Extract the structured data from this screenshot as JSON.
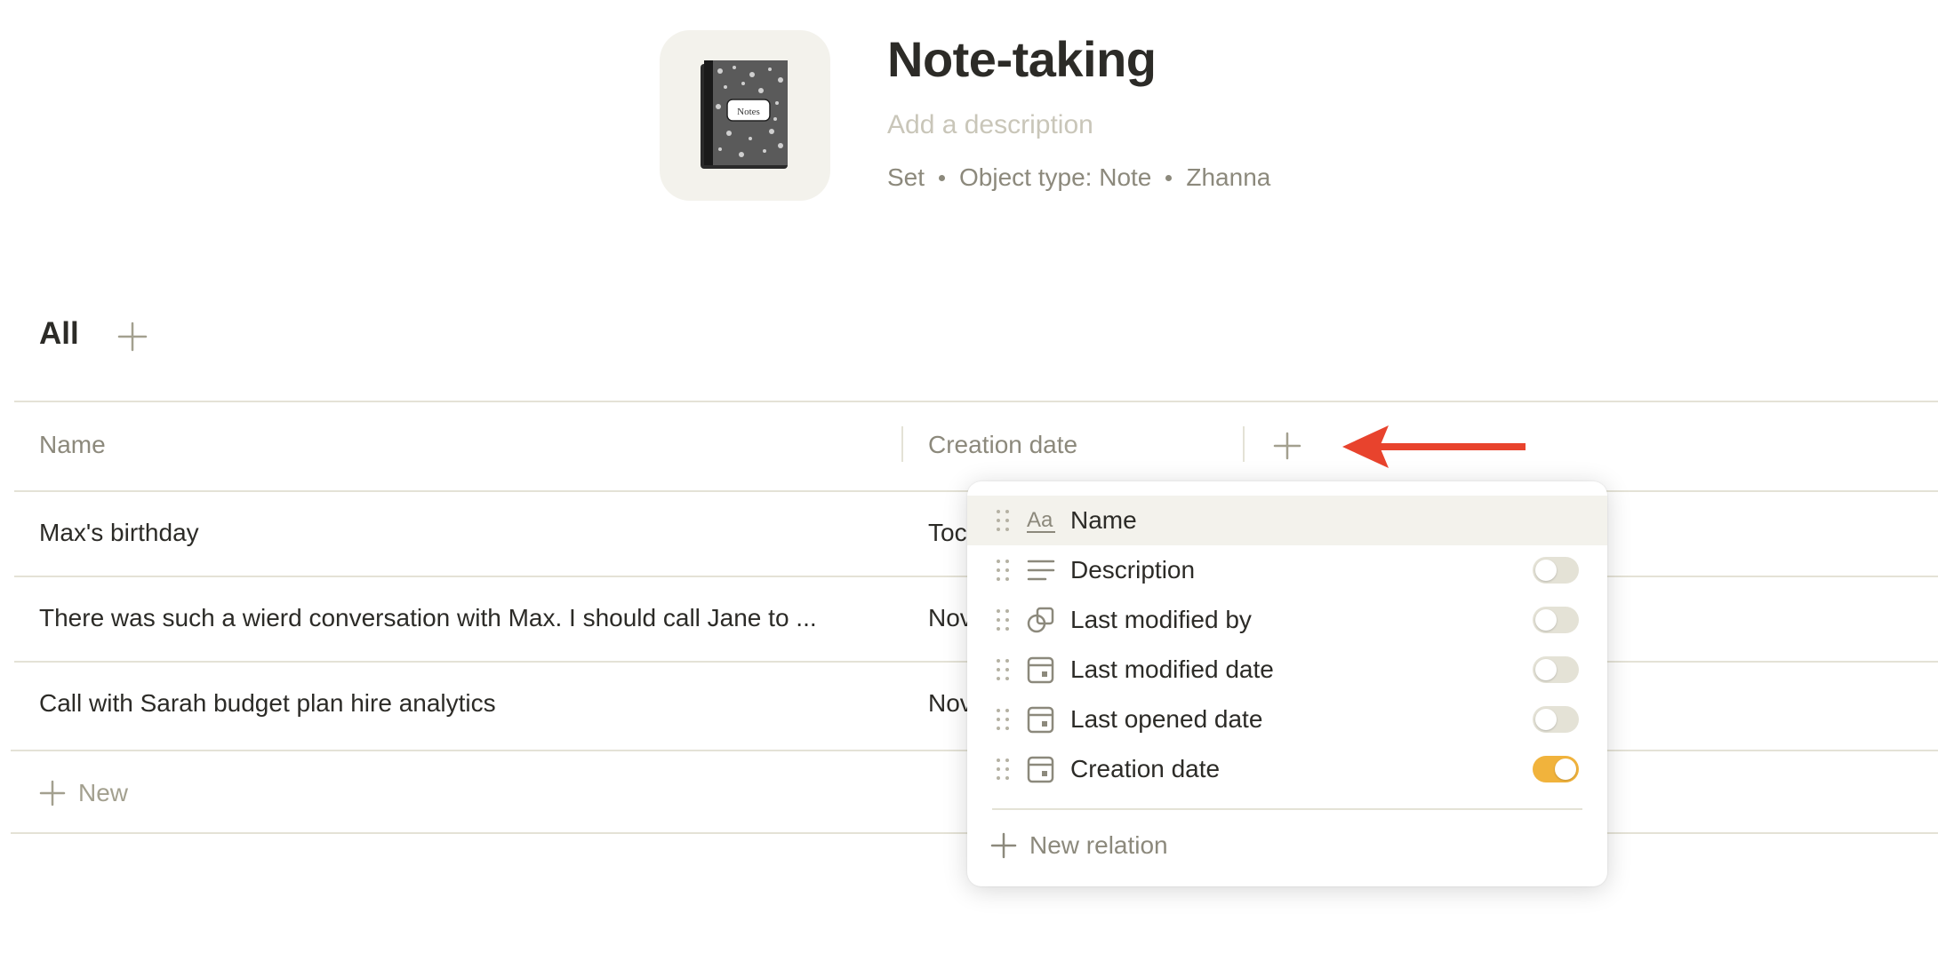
{
  "header": {
    "icon": "composition-notebook-icon",
    "icon_text": "Notes",
    "title": "Note-taking",
    "description_placeholder": "Add a description",
    "meta": [
      "Set",
      "Object type: Note",
      "Zhanna"
    ]
  },
  "views": {
    "active": "All"
  },
  "table": {
    "columns": [
      "Name",
      "Creation date"
    ],
    "rows": [
      {
        "name": "Max's birthday",
        "date": "Toc"
      },
      {
        "name": "There was such a wierd conversation with Max. I should call Jane to ...",
        "date": "Nov"
      },
      {
        "name": "Call with Sarah budget plan hire analytics",
        "date": "Nov"
      }
    ],
    "new_label": "New"
  },
  "relation_menu": {
    "items": [
      {
        "label": "Name",
        "icon": "text-aa-icon",
        "toggle": null
      },
      {
        "label": "Description",
        "icon": "lines-icon",
        "toggle": false
      },
      {
        "label": "Last modified by",
        "icon": "object-icon",
        "toggle": false
      },
      {
        "label": "Last modified date",
        "icon": "calendar-icon",
        "toggle": false
      },
      {
        "label": "Last opened date",
        "icon": "calendar-icon",
        "toggle": false
      },
      {
        "label": "Creation date",
        "icon": "calendar-icon",
        "toggle": true
      }
    ],
    "new_relation_label": "New relation"
  },
  "colors": {
    "accent_toggle": "#f1b33c",
    "annotation_arrow": "#e8432d",
    "muted_text": "#8c897c"
  }
}
